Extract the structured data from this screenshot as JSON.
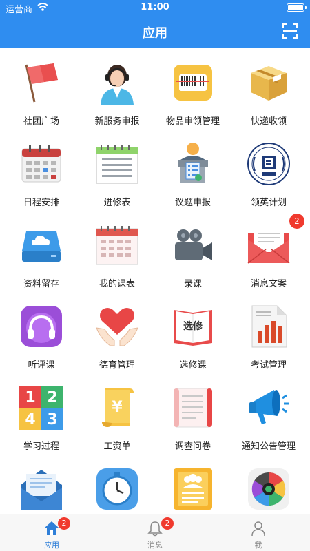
{
  "status_bar": {
    "carrier": "运营商",
    "time": "11:00"
  },
  "header": {
    "title": "应用"
  },
  "apps": [
    {
      "label": "社团广场",
      "icon": "red-flag-icon"
    },
    {
      "label": "新服务申报",
      "icon": "customer-service-agent-icon"
    },
    {
      "label": "物品申领管理",
      "icon": "barcode-icon"
    },
    {
      "label": "快递收领",
      "icon": "package-box-icon"
    },
    {
      "label": "日程安排",
      "icon": "calendar-icon"
    },
    {
      "label": "进修表",
      "icon": "list-board-icon"
    },
    {
      "label": "议题申报",
      "icon": "podium-speaker-icon"
    },
    {
      "label": "领英计划",
      "icon": "emblem-seal-icon"
    },
    {
      "label": "资料留存",
      "icon": "cloud-drive-icon"
    },
    {
      "label": "我的课表",
      "icon": "timetable-icon"
    },
    {
      "label": "录课",
      "icon": "video-camera-icon"
    },
    {
      "label": "消息文案",
      "icon": "envelope-icon",
      "badge": "2"
    },
    {
      "label": "听评课",
      "icon": "headphones-icon"
    },
    {
      "label": "德育管理",
      "icon": "heart-hands-icon"
    },
    {
      "label": "选修课",
      "icon": "elective-book-icon"
    },
    {
      "label": "考试管理",
      "icon": "exam-report-icon"
    },
    {
      "label": "学习过程",
      "icon": "number-blocks-icon"
    },
    {
      "label": "工资单",
      "icon": "yuan-scroll-icon"
    },
    {
      "label": "调查问卷",
      "icon": "questionnaire-scroll-icon"
    },
    {
      "label": "通知公告管理",
      "icon": "megaphone-icon"
    },
    {
      "label": "",
      "icon": "open-mail-icon"
    },
    {
      "label": "",
      "icon": "clock-icon"
    },
    {
      "label": "",
      "icon": "group-document-icon"
    },
    {
      "label": "",
      "icon": "colorful-wheel-icon"
    }
  ],
  "tabbar": {
    "tabs": [
      {
        "label": "应用",
        "icon": "home-icon",
        "badge": "2",
        "active": true
      },
      {
        "label": "消息",
        "icon": "bell-icon",
        "badge": "2"
      },
      {
        "label": "我",
        "icon": "person-icon"
      }
    ]
  },
  "colors": {
    "primary": "#2f8df0",
    "badge": "#f03a2e",
    "active_tab": "#2f7fd8"
  }
}
